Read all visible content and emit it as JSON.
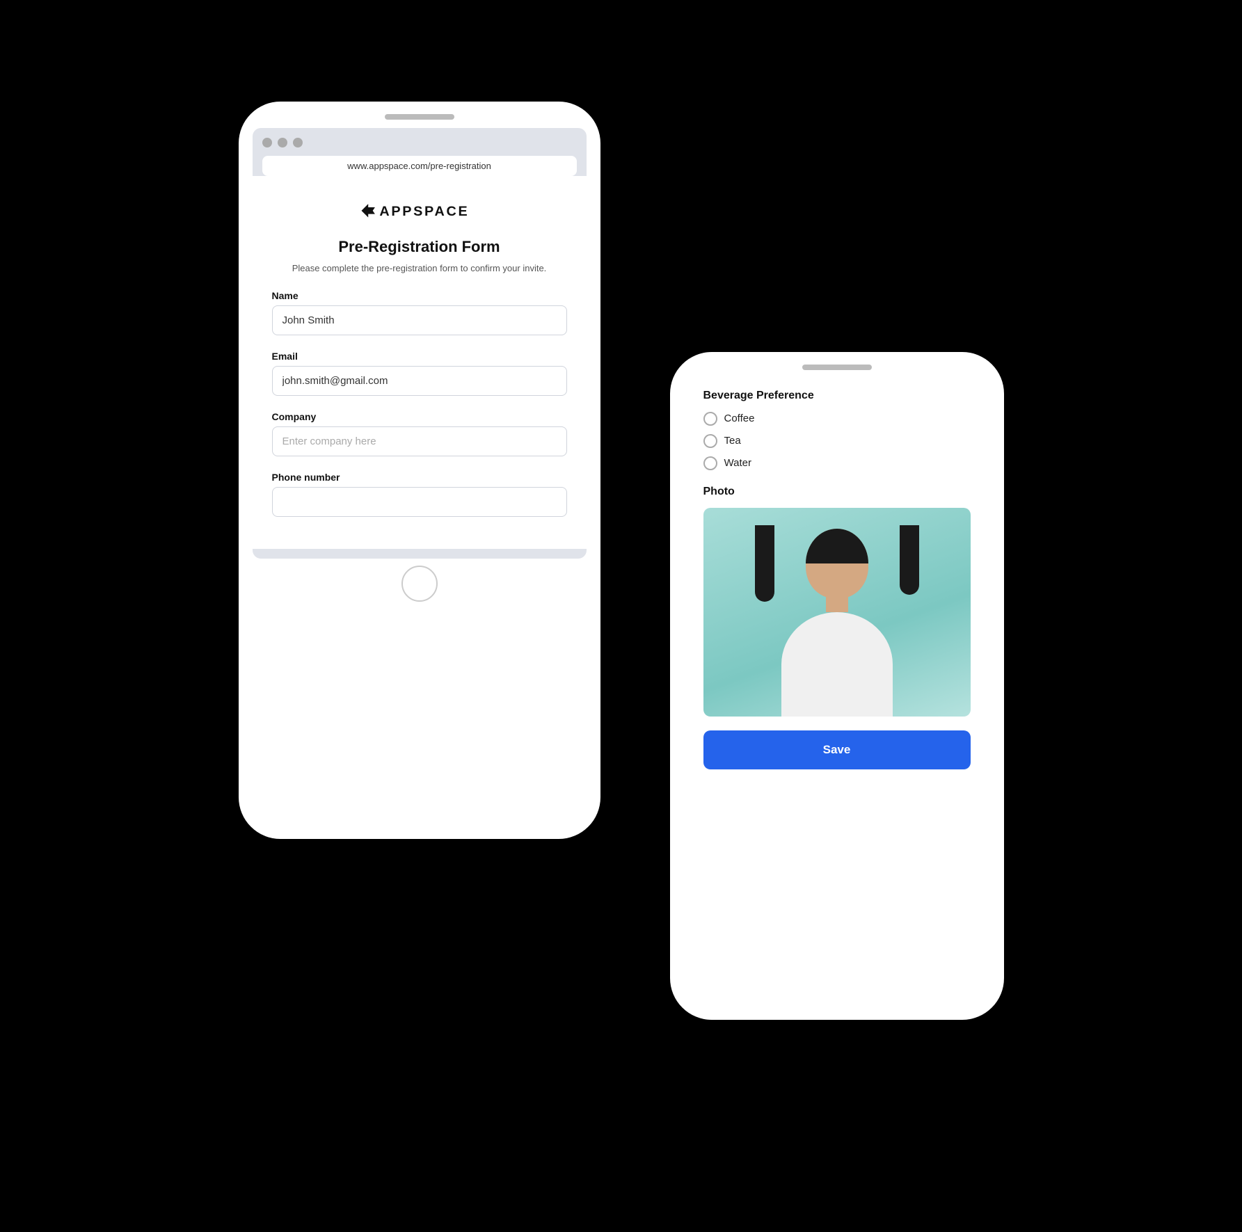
{
  "scene": {
    "background": "#000"
  },
  "left_phone": {
    "browser": {
      "url": "www.appspace.com/pre-registration",
      "dots": [
        "●",
        "●",
        "●"
      ]
    },
    "form": {
      "logo_text": "APPSPACE",
      "title": "Pre-Registration Form",
      "subtitle": "Please complete the pre-registration form to confirm your invite.",
      "fields": [
        {
          "label": "Name",
          "value": "John Smith",
          "placeholder": "John Smith",
          "type": "text",
          "name": "name-input"
        },
        {
          "label": "Email",
          "value": "john.smith@gmail.com",
          "placeholder": "john.smith@gmail.com",
          "type": "email",
          "name": "email-input"
        },
        {
          "label": "Company",
          "value": "",
          "placeholder": "Enter company here",
          "type": "text",
          "name": "company-input"
        },
        {
          "label": "Phone number",
          "value": "",
          "placeholder": "",
          "type": "tel",
          "name": "phone-input"
        }
      ]
    }
  },
  "right_phone": {
    "beverage": {
      "section_title": "Beverage Preference",
      "options": [
        "Coffee",
        "Tea",
        "Water"
      ]
    },
    "photo": {
      "section_title": "Photo"
    },
    "save_button": "Save"
  }
}
